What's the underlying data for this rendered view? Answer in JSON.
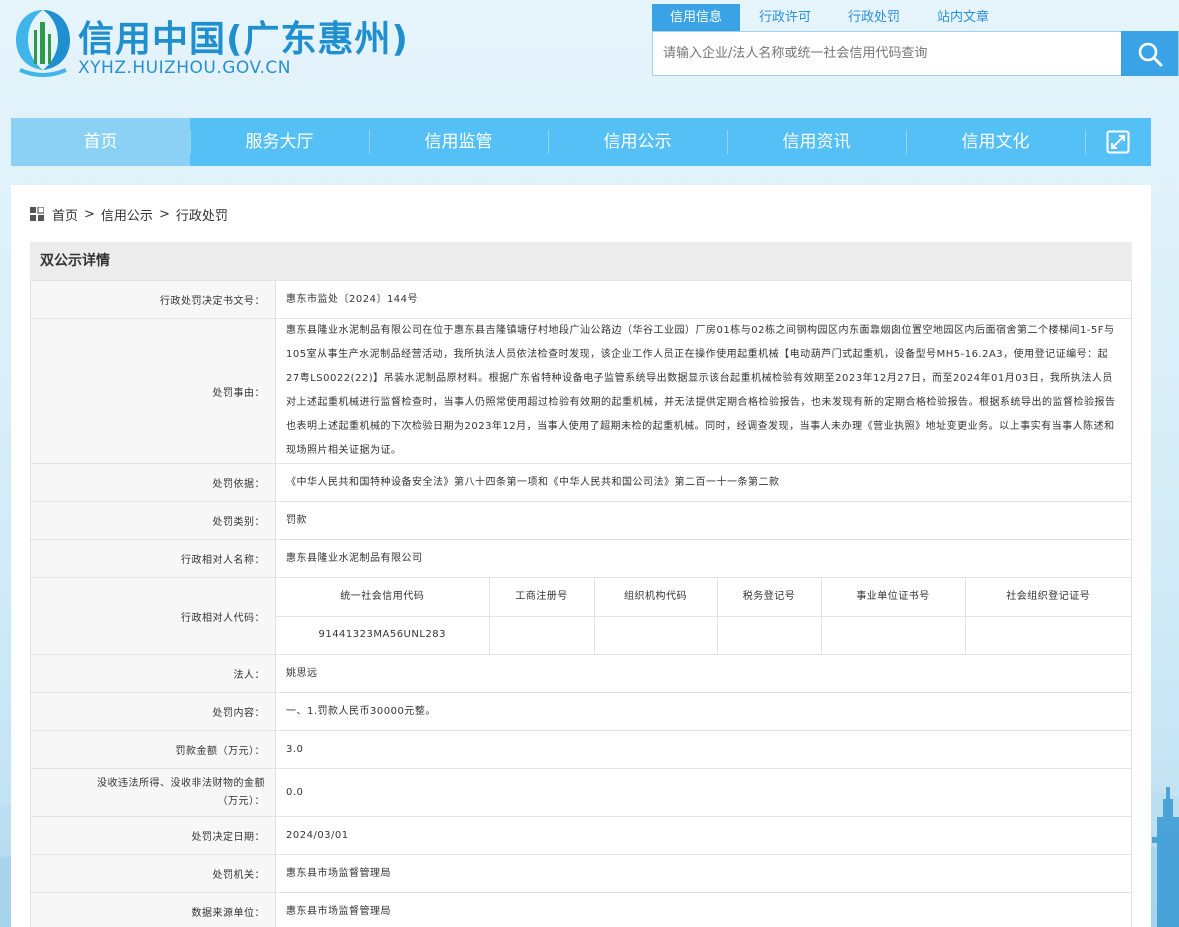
{
  "header": {
    "site_title": "信用中国(广东惠州)",
    "site_domain": "XYHZ.HUIZHOU.GOV.CN",
    "logo_icon": "city-skyline-logo-icon"
  },
  "search": {
    "tabs": [
      {
        "label": "信用信息",
        "active": true
      },
      {
        "label": "行政许可",
        "active": false
      },
      {
        "label": "行政处罚",
        "active": false
      },
      {
        "label": "站内文章",
        "active": false
      }
    ],
    "placeholder": "请输入企业/法人名称或统一社会信用代码查询",
    "button_icon": "search-icon"
  },
  "nav": {
    "items": [
      {
        "label": "首页",
        "active": true
      },
      {
        "label": "服务大厅",
        "active": false
      },
      {
        "label": "信用监管",
        "active": false
      },
      {
        "label": "信用公示",
        "active": false
      },
      {
        "label": "信用资讯",
        "active": false
      },
      {
        "label": "信用文化",
        "active": false
      }
    ],
    "expand_icon": "expand-icon"
  },
  "breadcrumb": {
    "icon": "grid-icon",
    "items": [
      "首页",
      "信用公示",
      "行政处罚"
    ],
    "separator": ">"
  },
  "detail": {
    "header": "双公示详情",
    "rows": {
      "doc_no": {
        "label": "行政处罚决定书文号：",
        "value": "惠东市监处〔2024〕144号"
      },
      "facts": {
        "label": "处罚事由：",
        "value": "惠东县隆业水泥制品有限公司在位于惠东县吉隆镇塘仔村地段广汕公路边（华谷工业园）厂房01栋与02栋之间钢构园区内东面靠烟囱位置空地园区内后面宿舍第二个楼梯间1-5F与105室从事生产水泥制品经营活动，我所执法人员依法检查时发现，该企业工作人员正在操作使用起重机械【电动葫芦门式起重机，设备型号MH5-16.2A3，使用登记证编号：起27粤LS0022(22)】吊装水泥制品原材料。根据广东省特种设备电子监管系统导出数据显示该台起重机械检验有效期至2023年12月27日，而至2024年01月03日，我所执法人员对上述起重机械进行监督检查时，当事人仍照常使用超过检验有效期的起重机械，并无法提供定期合格检验报告，也未发现有新的定期合格检验报告。根据系统导出的监督检验报告也表明上述起重机械的下次检验日期为2023年12月，当事人使用了超期未检的起重机械。同时，经调查发现，当事人未办理《营业执照》地址变更业务。以上事实有当事人陈述和现场照片相关证据为证。"
      },
      "basis": {
        "label": "处罚依据：",
        "value": "《中华人民共和国特种设备安全法》第八十四条第一项和《中华人民共和国公司法》第二百一十一条第二款"
      },
      "category": {
        "label": "处罚类别：",
        "value": "罚款"
      },
      "party_name": {
        "label": "行政相对人名称：",
        "value": "惠东县隆业水泥制品有限公司"
      },
      "party_code": {
        "label": "行政相对人代码：",
        "headers": [
          "统一社会信用代码",
          "工商注册号",
          "组织机构代码",
          "税务登记号",
          "事业单位证书号",
          "社会组织登记证号"
        ],
        "values": [
          "91441323MA56UNL283",
          "",
          "",
          "",
          "",
          ""
        ]
      },
      "legal_person": {
        "label": "法人：",
        "value": "姚思远"
      },
      "content": {
        "label": "处罚内容：",
        "value": "一、1.罚款人民币30000元整。"
      },
      "fine": {
        "label": "罚款金额（万元）：",
        "value": "3.0"
      },
      "confiscation": {
        "label": "没收违法所得、没收非法财物的金额（万元）：",
        "value": "0.0"
      },
      "decision_date": {
        "label": "处罚决定日期：",
        "value": "2024/03/01"
      },
      "authority": {
        "label": "处罚机关：",
        "value": "惠东县市场监督管理局"
      },
      "source_unit": {
        "label": "数据来源单位：",
        "value": "惠东县市场监督管理局"
      }
    }
  }
}
